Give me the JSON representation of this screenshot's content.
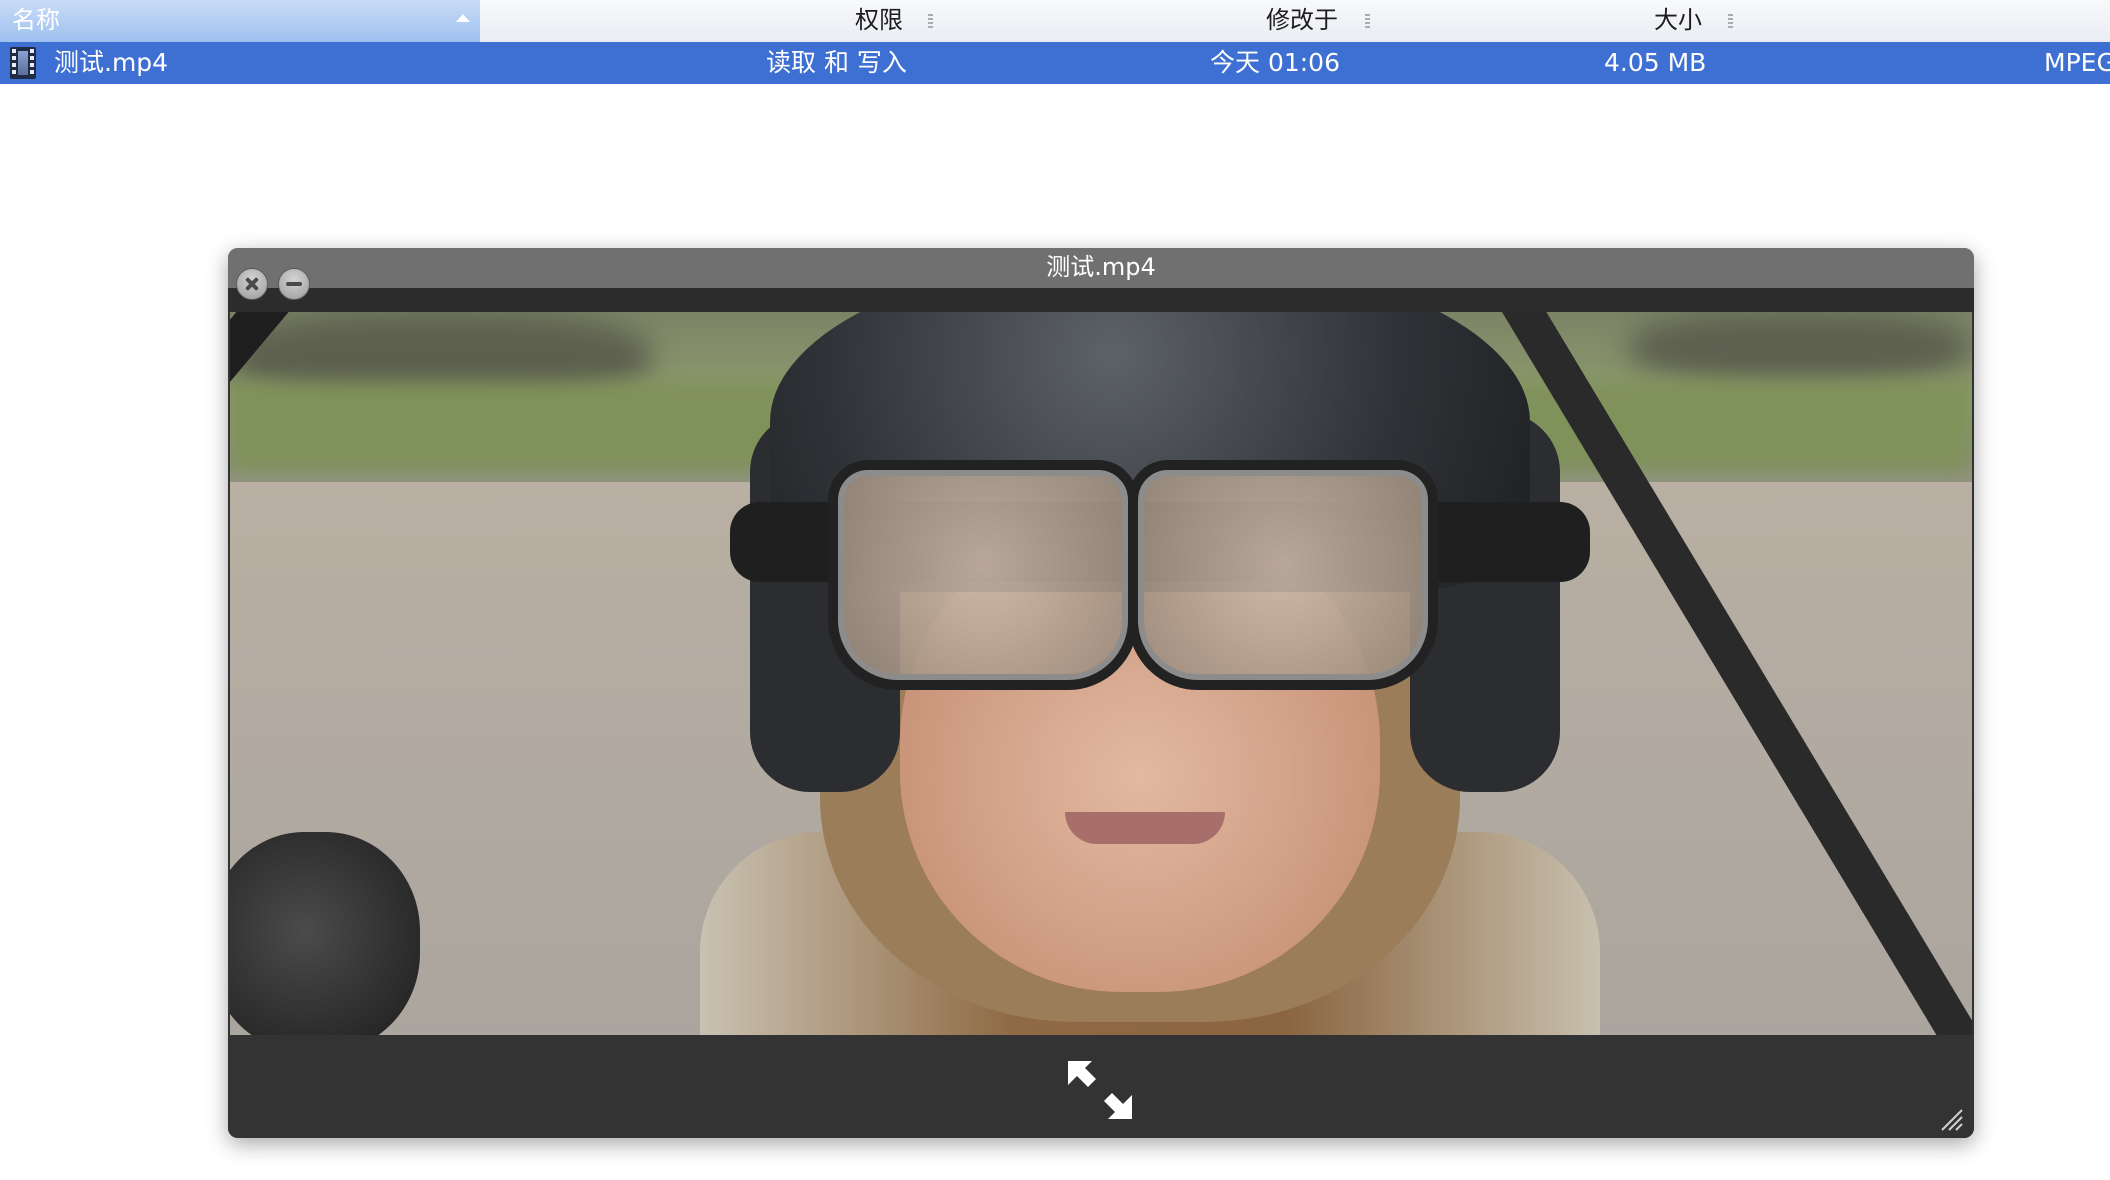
{
  "list": {
    "columns": {
      "name": "名称",
      "permissions": "权限",
      "modified": "修改于",
      "size": "大小"
    },
    "row": {
      "name": "测试.mp4",
      "permissions": "读取 和 写入",
      "modified": "今天 01:06",
      "size": "4.05 MB",
      "kind": "MPEG"
    },
    "colors": {
      "selection": "#3e6fd2",
      "sorted_header": "#9dc0ef"
    }
  },
  "quicklook": {
    "title": "测试.mp4",
    "icons": {
      "close": "close-icon",
      "minimize": "minimize-icon",
      "fullscreen": "fullscreen-icon",
      "resize": "resize-grip-icon"
    }
  }
}
